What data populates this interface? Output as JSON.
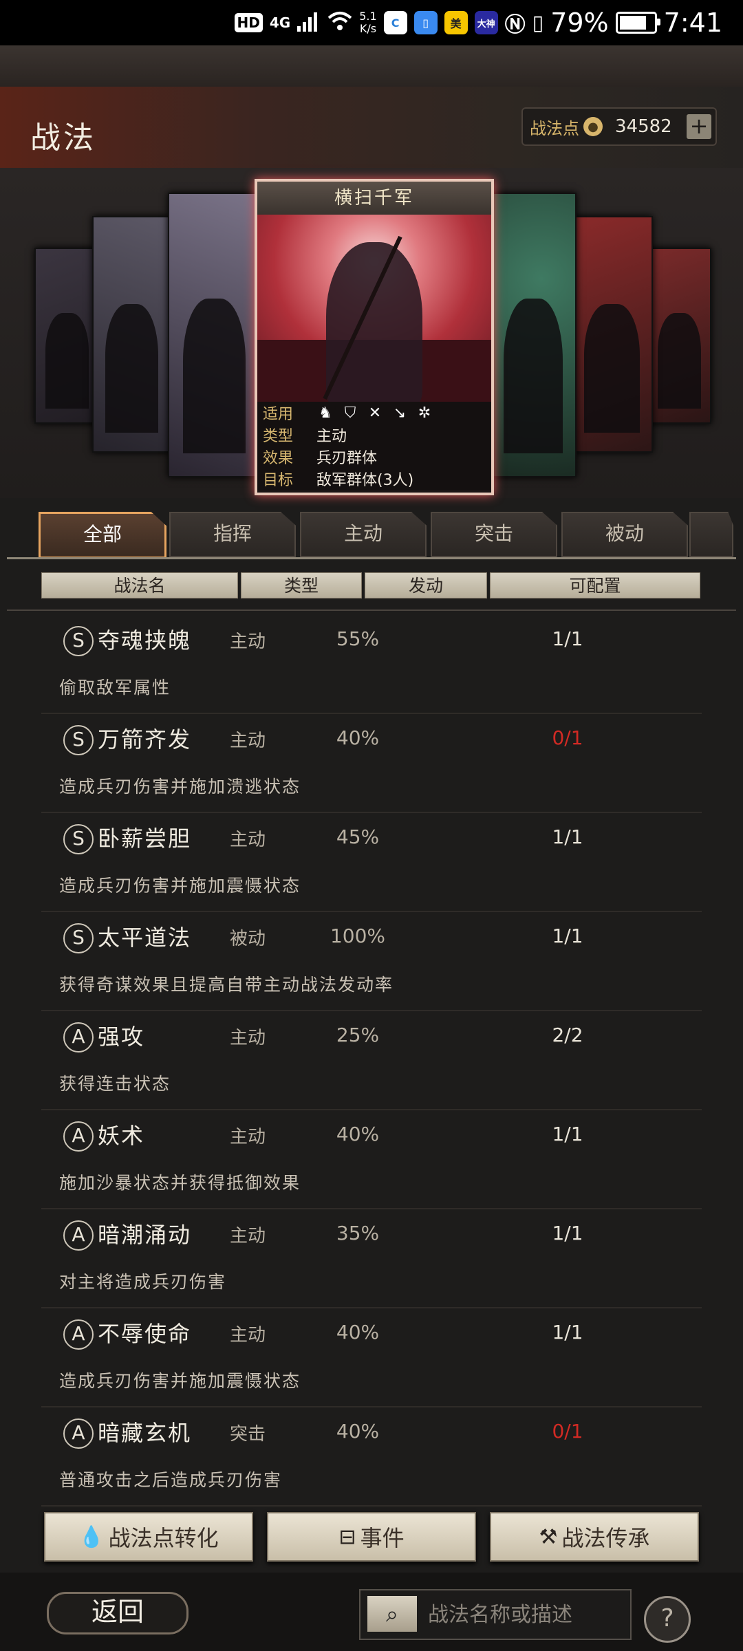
{
  "status_bar": {
    "time": "7:41",
    "battery": "79%",
    "net_speed_top": "5.1",
    "net_speed_bottom": "K/s",
    "hd": "HD",
    "signal": "4G",
    "app_mei": "美",
    "app_dashen": "大神"
  },
  "header": {
    "title": "战法",
    "points_label": "战法点",
    "points_value": "34582",
    "plus": "+"
  },
  "featured_card": {
    "name": "横扫千军",
    "labels": {
      "use": "适用",
      "type": "类型",
      "effect": "效果",
      "target": "目标"
    },
    "type": "主动",
    "effect": "兵刃群体",
    "target": "敌军群体(3人)",
    "icons": [
      "cavalry-icon",
      "shield-icon",
      "bow-icon",
      "spear-icon",
      "siege-icon"
    ]
  },
  "tabs": [
    {
      "label": "全部",
      "active": true
    },
    {
      "label": "指挥"
    },
    {
      "label": "主动"
    },
    {
      "label": "突击"
    },
    {
      "label": "被动"
    }
  ],
  "columns": [
    "战法名",
    "类型",
    "发动",
    "可配置"
  ],
  "skills": [
    {
      "rank": "S",
      "name": "夺魂挟魄",
      "type": "主动",
      "rate": "55%",
      "config": "1/1",
      "zero": false,
      "desc": "偷取敌军属性"
    },
    {
      "rank": "S",
      "name": "万箭齐发",
      "type": "主动",
      "rate": "40%",
      "config": "0/1",
      "zero": true,
      "desc": "造成兵刃伤害并施加溃逃状态"
    },
    {
      "rank": "S",
      "name": "卧薪尝胆",
      "type": "主动",
      "rate": "45%",
      "config": "1/1",
      "zero": false,
      "desc": "造成兵刃伤害并施加震慑状态"
    },
    {
      "rank": "S",
      "name": "太平道法",
      "type": "被动",
      "rate": "100%",
      "config": "1/1",
      "zero": false,
      "desc": "获得奇谋效果且提高自带主动战法发动率"
    },
    {
      "rank": "A",
      "name": "强攻",
      "type": "主动",
      "rate": "25%",
      "config": "2/2",
      "zero": false,
      "desc": "获得连击状态"
    },
    {
      "rank": "A",
      "name": "妖术",
      "type": "主动",
      "rate": "40%",
      "config": "1/1",
      "zero": false,
      "desc": "施加沙暴状态并获得抵御效果"
    },
    {
      "rank": "A",
      "name": "暗潮涌动",
      "type": "主动",
      "rate": "35%",
      "config": "1/1",
      "zero": false,
      "desc": "对主将造成兵刃伤害"
    },
    {
      "rank": "A",
      "name": "不辱使命",
      "type": "主动",
      "rate": "40%",
      "config": "1/1",
      "zero": false,
      "desc": "造成兵刃伤害并施加震慑状态"
    },
    {
      "rank": "A",
      "name": "暗藏玄机",
      "type": "突击",
      "rate": "40%",
      "config": "0/1",
      "zero": true,
      "desc": "普通攻击之后造成兵刃伤害"
    }
  ],
  "bottom_buttons": [
    {
      "label": "战法点转化",
      "icon": "drop-icon"
    },
    {
      "label": "事件",
      "icon": "event-icon"
    },
    {
      "label": "战法传承",
      "icon": "hammer-icon"
    }
  ],
  "footer": {
    "back_label": "返回",
    "search_placeholder": "战法名称或描述",
    "help": "?"
  }
}
